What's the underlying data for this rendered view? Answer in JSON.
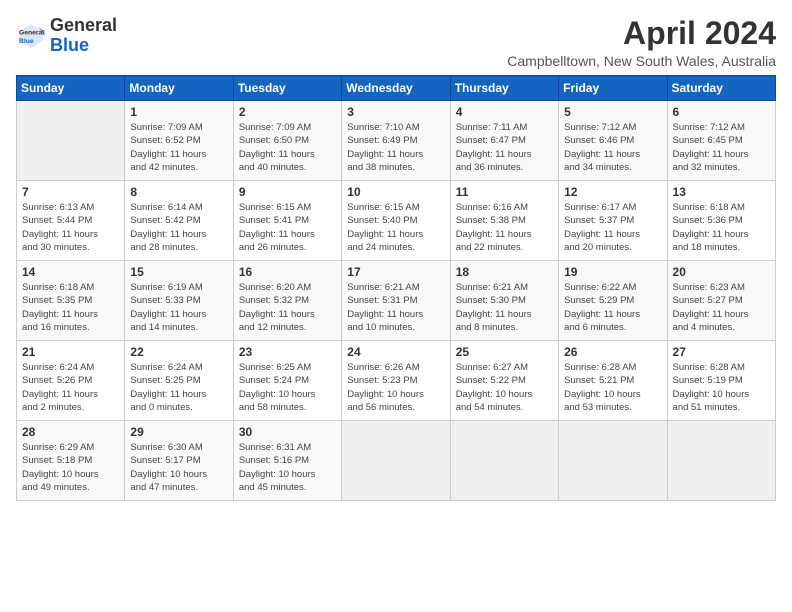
{
  "header": {
    "logo_general": "General",
    "logo_blue": "Blue",
    "month_title": "April 2024",
    "location": "Campbelltown, New South Wales, Australia"
  },
  "calendar": {
    "days_of_week": [
      "Sunday",
      "Monday",
      "Tuesday",
      "Wednesday",
      "Thursday",
      "Friday",
      "Saturday"
    ],
    "weeks": [
      [
        {
          "day": "",
          "content": ""
        },
        {
          "day": "1",
          "content": "Sunrise: 7:09 AM\nSunset: 6:52 PM\nDaylight: 11 hours\nand 42 minutes."
        },
        {
          "day": "2",
          "content": "Sunrise: 7:09 AM\nSunset: 6:50 PM\nDaylight: 11 hours\nand 40 minutes."
        },
        {
          "day": "3",
          "content": "Sunrise: 7:10 AM\nSunset: 6:49 PM\nDaylight: 11 hours\nand 38 minutes."
        },
        {
          "day": "4",
          "content": "Sunrise: 7:11 AM\nSunset: 6:47 PM\nDaylight: 11 hours\nand 36 minutes."
        },
        {
          "day": "5",
          "content": "Sunrise: 7:12 AM\nSunset: 6:46 PM\nDaylight: 11 hours\nand 34 minutes."
        },
        {
          "day": "6",
          "content": "Sunrise: 7:12 AM\nSunset: 6:45 PM\nDaylight: 11 hours\nand 32 minutes."
        }
      ],
      [
        {
          "day": "7",
          "content": "Sunrise: 6:13 AM\nSunset: 5:44 PM\nDaylight: 11 hours\nand 30 minutes."
        },
        {
          "day": "8",
          "content": "Sunrise: 6:14 AM\nSunset: 5:42 PM\nDaylight: 11 hours\nand 28 minutes."
        },
        {
          "day": "9",
          "content": "Sunrise: 6:15 AM\nSunset: 5:41 PM\nDaylight: 11 hours\nand 26 minutes."
        },
        {
          "day": "10",
          "content": "Sunrise: 6:15 AM\nSunset: 5:40 PM\nDaylight: 11 hours\nand 24 minutes."
        },
        {
          "day": "11",
          "content": "Sunrise: 6:16 AM\nSunset: 5:38 PM\nDaylight: 11 hours\nand 22 minutes."
        },
        {
          "day": "12",
          "content": "Sunrise: 6:17 AM\nSunset: 5:37 PM\nDaylight: 11 hours\nand 20 minutes."
        },
        {
          "day": "13",
          "content": "Sunrise: 6:18 AM\nSunset: 5:36 PM\nDaylight: 11 hours\nand 18 minutes."
        }
      ],
      [
        {
          "day": "14",
          "content": "Sunrise: 6:18 AM\nSunset: 5:35 PM\nDaylight: 11 hours\nand 16 minutes."
        },
        {
          "day": "15",
          "content": "Sunrise: 6:19 AM\nSunset: 5:33 PM\nDaylight: 11 hours\nand 14 minutes."
        },
        {
          "day": "16",
          "content": "Sunrise: 6:20 AM\nSunset: 5:32 PM\nDaylight: 11 hours\nand 12 minutes."
        },
        {
          "day": "17",
          "content": "Sunrise: 6:21 AM\nSunset: 5:31 PM\nDaylight: 11 hours\nand 10 minutes."
        },
        {
          "day": "18",
          "content": "Sunrise: 6:21 AM\nSunset: 5:30 PM\nDaylight: 11 hours\nand 8 minutes."
        },
        {
          "day": "19",
          "content": "Sunrise: 6:22 AM\nSunset: 5:29 PM\nDaylight: 11 hours\nand 6 minutes."
        },
        {
          "day": "20",
          "content": "Sunrise: 6:23 AM\nSunset: 5:27 PM\nDaylight: 11 hours\nand 4 minutes."
        }
      ],
      [
        {
          "day": "21",
          "content": "Sunrise: 6:24 AM\nSunset: 5:26 PM\nDaylight: 11 hours\nand 2 minutes."
        },
        {
          "day": "22",
          "content": "Sunrise: 6:24 AM\nSunset: 5:25 PM\nDaylight: 11 hours\nand 0 minutes."
        },
        {
          "day": "23",
          "content": "Sunrise: 6:25 AM\nSunset: 5:24 PM\nDaylight: 10 hours\nand 58 minutes."
        },
        {
          "day": "24",
          "content": "Sunrise: 6:26 AM\nSunset: 5:23 PM\nDaylight: 10 hours\nand 56 minutes."
        },
        {
          "day": "25",
          "content": "Sunrise: 6:27 AM\nSunset: 5:22 PM\nDaylight: 10 hours\nand 54 minutes."
        },
        {
          "day": "26",
          "content": "Sunrise: 6:28 AM\nSunset: 5:21 PM\nDaylight: 10 hours\nand 53 minutes."
        },
        {
          "day": "27",
          "content": "Sunrise: 6:28 AM\nSunset: 5:19 PM\nDaylight: 10 hours\nand 51 minutes."
        }
      ],
      [
        {
          "day": "28",
          "content": "Sunrise: 6:29 AM\nSunset: 5:18 PM\nDaylight: 10 hours\nand 49 minutes."
        },
        {
          "day": "29",
          "content": "Sunrise: 6:30 AM\nSunset: 5:17 PM\nDaylight: 10 hours\nand 47 minutes."
        },
        {
          "day": "30",
          "content": "Sunrise: 6:31 AM\nSunset: 5:16 PM\nDaylight: 10 hours\nand 45 minutes."
        },
        {
          "day": "",
          "content": ""
        },
        {
          "day": "",
          "content": ""
        },
        {
          "day": "",
          "content": ""
        },
        {
          "day": "",
          "content": ""
        }
      ]
    ]
  }
}
